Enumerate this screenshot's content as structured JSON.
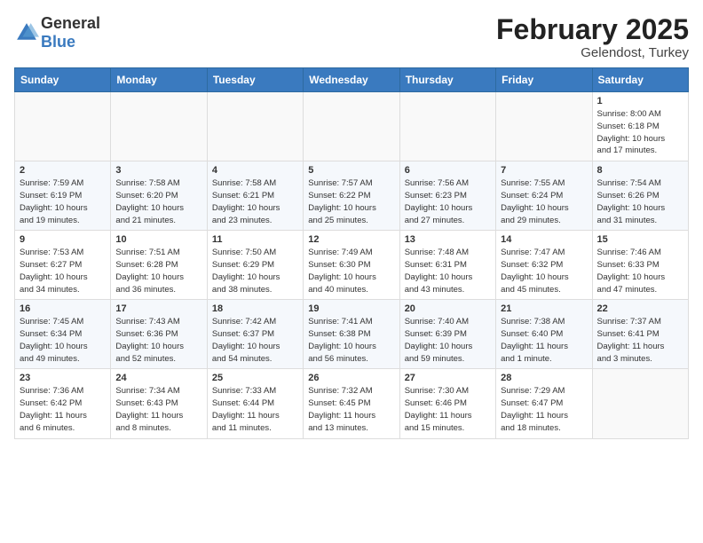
{
  "logo": {
    "general": "General",
    "blue": "Blue"
  },
  "header": {
    "month_year": "February 2025",
    "location": "Gelendost, Turkey"
  },
  "weekdays": [
    "Sunday",
    "Monday",
    "Tuesday",
    "Wednesday",
    "Thursday",
    "Friday",
    "Saturday"
  ],
  "weeks": [
    [
      {
        "day": "",
        "info": ""
      },
      {
        "day": "",
        "info": ""
      },
      {
        "day": "",
        "info": ""
      },
      {
        "day": "",
        "info": ""
      },
      {
        "day": "",
        "info": ""
      },
      {
        "day": "",
        "info": ""
      },
      {
        "day": "1",
        "info": "Sunrise: 8:00 AM\nSunset: 6:18 PM\nDaylight: 10 hours\nand 17 minutes."
      }
    ],
    [
      {
        "day": "2",
        "info": "Sunrise: 7:59 AM\nSunset: 6:19 PM\nDaylight: 10 hours\nand 19 minutes."
      },
      {
        "day": "3",
        "info": "Sunrise: 7:58 AM\nSunset: 6:20 PM\nDaylight: 10 hours\nand 21 minutes."
      },
      {
        "day": "4",
        "info": "Sunrise: 7:58 AM\nSunset: 6:21 PM\nDaylight: 10 hours\nand 23 minutes."
      },
      {
        "day": "5",
        "info": "Sunrise: 7:57 AM\nSunset: 6:22 PM\nDaylight: 10 hours\nand 25 minutes."
      },
      {
        "day": "6",
        "info": "Sunrise: 7:56 AM\nSunset: 6:23 PM\nDaylight: 10 hours\nand 27 minutes."
      },
      {
        "day": "7",
        "info": "Sunrise: 7:55 AM\nSunset: 6:24 PM\nDaylight: 10 hours\nand 29 minutes."
      },
      {
        "day": "8",
        "info": "Sunrise: 7:54 AM\nSunset: 6:26 PM\nDaylight: 10 hours\nand 31 minutes."
      }
    ],
    [
      {
        "day": "9",
        "info": "Sunrise: 7:53 AM\nSunset: 6:27 PM\nDaylight: 10 hours\nand 34 minutes."
      },
      {
        "day": "10",
        "info": "Sunrise: 7:51 AM\nSunset: 6:28 PM\nDaylight: 10 hours\nand 36 minutes."
      },
      {
        "day": "11",
        "info": "Sunrise: 7:50 AM\nSunset: 6:29 PM\nDaylight: 10 hours\nand 38 minutes."
      },
      {
        "day": "12",
        "info": "Sunrise: 7:49 AM\nSunset: 6:30 PM\nDaylight: 10 hours\nand 40 minutes."
      },
      {
        "day": "13",
        "info": "Sunrise: 7:48 AM\nSunset: 6:31 PM\nDaylight: 10 hours\nand 43 minutes."
      },
      {
        "day": "14",
        "info": "Sunrise: 7:47 AM\nSunset: 6:32 PM\nDaylight: 10 hours\nand 45 minutes."
      },
      {
        "day": "15",
        "info": "Sunrise: 7:46 AM\nSunset: 6:33 PM\nDaylight: 10 hours\nand 47 minutes."
      }
    ],
    [
      {
        "day": "16",
        "info": "Sunrise: 7:45 AM\nSunset: 6:34 PM\nDaylight: 10 hours\nand 49 minutes."
      },
      {
        "day": "17",
        "info": "Sunrise: 7:43 AM\nSunset: 6:36 PM\nDaylight: 10 hours\nand 52 minutes."
      },
      {
        "day": "18",
        "info": "Sunrise: 7:42 AM\nSunset: 6:37 PM\nDaylight: 10 hours\nand 54 minutes."
      },
      {
        "day": "19",
        "info": "Sunrise: 7:41 AM\nSunset: 6:38 PM\nDaylight: 10 hours\nand 56 minutes."
      },
      {
        "day": "20",
        "info": "Sunrise: 7:40 AM\nSunset: 6:39 PM\nDaylight: 10 hours\nand 59 minutes."
      },
      {
        "day": "21",
        "info": "Sunrise: 7:38 AM\nSunset: 6:40 PM\nDaylight: 11 hours\nand 1 minute."
      },
      {
        "day": "22",
        "info": "Sunrise: 7:37 AM\nSunset: 6:41 PM\nDaylight: 11 hours\nand 3 minutes."
      }
    ],
    [
      {
        "day": "23",
        "info": "Sunrise: 7:36 AM\nSunset: 6:42 PM\nDaylight: 11 hours\nand 6 minutes."
      },
      {
        "day": "24",
        "info": "Sunrise: 7:34 AM\nSunset: 6:43 PM\nDaylight: 11 hours\nand 8 minutes."
      },
      {
        "day": "25",
        "info": "Sunrise: 7:33 AM\nSunset: 6:44 PM\nDaylight: 11 hours\nand 11 minutes."
      },
      {
        "day": "26",
        "info": "Sunrise: 7:32 AM\nSunset: 6:45 PM\nDaylight: 11 hours\nand 13 minutes."
      },
      {
        "day": "27",
        "info": "Sunrise: 7:30 AM\nSunset: 6:46 PM\nDaylight: 11 hours\nand 15 minutes."
      },
      {
        "day": "28",
        "info": "Sunrise: 7:29 AM\nSunset: 6:47 PM\nDaylight: 11 hours\nand 18 minutes."
      },
      {
        "day": "",
        "info": ""
      }
    ]
  ]
}
